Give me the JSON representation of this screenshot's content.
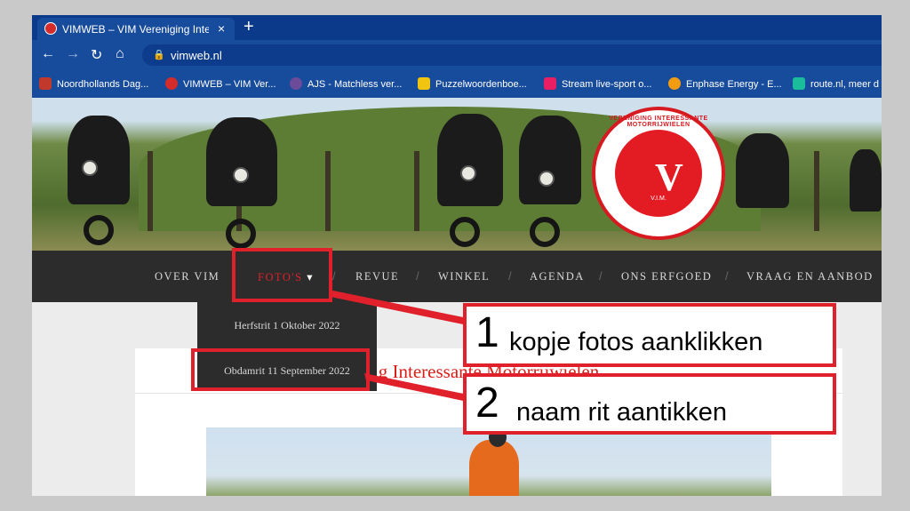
{
  "browser": {
    "tab_title": "VIMWEB – VIM Vereniging Interessante Motorrijwielen",
    "tab_close": "×",
    "new_tab": "+",
    "url": "vimweb.nl",
    "bookmarks": [
      {
        "label": "Noordhollands Dag...",
        "color": "#c0392b"
      },
      {
        "label": "VIMWEB – VIM Ver...",
        "color": "#d42b2b"
      },
      {
        "label": "AJS - Matchless ver...",
        "color": "#6b4b9a"
      },
      {
        "label": "Puzzelwoordenboe...",
        "color": "#f1c40f"
      },
      {
        "label": "Stream live-sport o...",
        "color": "#e91e63"
      },
      {
        "label": "Enphase Energy - E...",
        "color": "#f39c12"
      },
      {
        "label": "route.nl, meer d",
        "color": "#1abc9c"
      }
    ]
  },
  "site": {
    "logo_ring_text": "VERENIGING INTERESSANTE MOTORRIJWIELEN",
    "logo_center": "V.I.M.",
    "menu": [
      "OVER VIM",
      "FOTO'S",
      "REVUE",
      "WINKEL",
      "AGENDA",
      "ONS ERFGOED",
      "VRAAG EN AANBOD"
    ],
    "menu_separator": "/",
    "dropdown_arrow": "▾",
    "dropdown_items": [
      "Herfstrit 1 Oktober 2022",
      "Obdamrit 11 September 2022"
    ],
    "site_title_visible": "g Interessante Motorrijwielen"
  },
  "annotations": [
    {
      "number": "1",
      "text": "kopje fotos aanklikken"
    },
    {
      "number": "2",
      "text": "naam rit aantikken"
    }
  ],
  "colors": {
    "accent_red": "#e0202a",
    "menu_bg": "#2c2c2c",
    "browser_blue": "#174b9c"
  }
}
